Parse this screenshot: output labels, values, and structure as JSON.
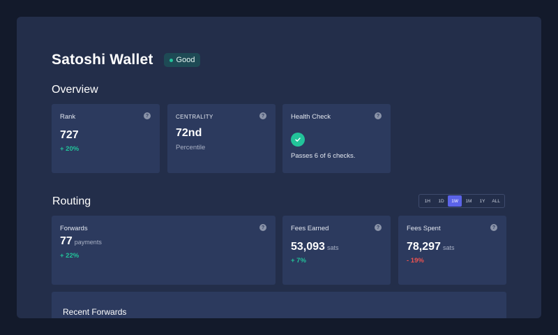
{
  "app": {
    "title": "Satoshi Wallet",
    "status_label": "Good"
  },
  "colors": {
    "positive": "#22c39a",
    "negative": "#ef5350",
    "accent": "#5b63e8",
    "card": "#2c3a5e",
    "panel": "#232e4a"
  },
  "overview": {
    "title": "Overview",
    "rank": {
      "label": "Rank",
      "value": "727",
      "delta": "+ 20%"
    },
    "centrality": {
      "label": "CENTRALITY",
      "value": "72nd",
      "sub": "Percentile"
    },
    "health": {
      "label": "Health Check",
      "text": "Passes 6 of 6 checks."
    }
  },
  "routing": {
    "title": "Routing",
    "ranges": [
      "1H",
      "1D",
      "1W",
      "1M",
      "1Y",
      "ALL"
    ],
    "active_range": "1W",
    "forwards": {
      "label": "Forwards",
      "value": "77",
      "unit": "payments",
      "delta": "+ 22%"
    },
    "fees_earned": {
      "label": "Fees Earned",
      "value": "53,093",
      "unit": "sats",
      "delta": "+ 7%"
    },
    "fees_spent": {
      "label": "Fees Spent",
      "value": "78,297",
      "unit": "sats",
      "delta": "- 19%"
    }
  },
  "recent": {
    "title": "Recent Forwards"
  },
  "help_glyph": "?"
}
